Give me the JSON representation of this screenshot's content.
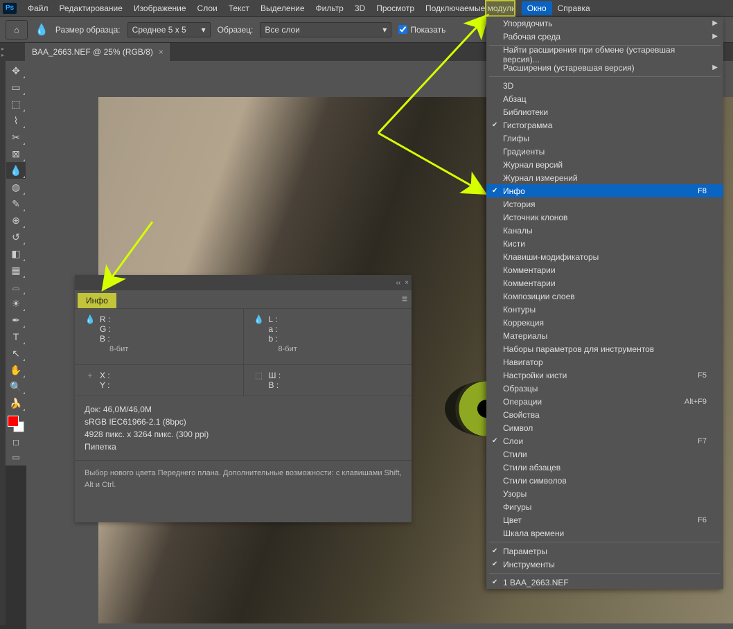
{
  "app": {
    "icon_label": "Ps"
  },
  "menubar": [
    "Файл",
    "Редактирование",
    "Изображение",
    "Слои",
    "Текст",
    "Выделение",
    "Фильтр",
    "3D",
    "Просмотр",
    "Подключаемые модули",
    "Окно",
    "Справка"
  ],
  "menubar_highlight_index": 10,
  "options": {
    "sample_label": "Размер образца:",
    "sample_value": "Среднее 5 x 5",
    "layers_label": "Образец:",
    "layers_value": "Все слои",
    "show_label": "Показать"
  },
  "doc_tab": "BAA_2663.NEF @ 25% (RGB/8)",
  "window_menu": {
    "groups": [
      [
        {
          "label": "Упорядочить",
          "sub": true
        },
        {
          "label": "Рабочая среда",
          "sub": true
        }
      ],
      [
        {
          "label": "Найти расширения при обмене (устаревшая версия)..."
        },
        {
          "label": "Расширения (устаревшая версия)",
          "sub": true
        }
      ],
      [
        {
          "label": "3D"
        },
        {
          "label": "Абзац"
        },
        {
          "label": "Библиотеки"
        },
        {
          "label": "Гистограмма",
          "chk": true
        },
        {
          "label": "Глифы"
        },
        {
          "label": "Градиенты"
        },
        {
          "label": "Журнал версий"
        },
        {
          "label": "Журнал измерений"
        },
        {
          "label": "Инфо",
          "chk": true,
          "sel": true,
          "short": "F8"
        },
        {
          "label": "История"
        },
        {
          "label": "Источник клонов"
        },
        {
          "label": "Каналы"
        },
        {
          "label": "Кисти"
        },
        {
          "label": "Клавиши-модификаторы"
        },
        {
          "label": "Комментарии"
        },
        {
          "label": "Комментарии"
        },
        {
          "label": "Композиции слоев"
        },
        {
          "label": "Контуры"
        },
        {
          "label": "Коррекция"
        },
        {
          "label": "Материалы"
        },
        {
          "label": "Наборы параметров для инструментов"
        },
        {
          "label": "Навигатор"
        },
        {
          "label": "Настройки кисти",
          "short": "F5"
        },
        {
          "label": "Образцы"
        },
        {
          "label": "Операции",
          "short": "Alt+F9"
        },
        {
          "label": "Свойства"
        },
        {
          "label": "Символ"
        },
        {
          "label": "Слои",
          "chk": true,
          "short": "F7"
        },
        {
          "label": "Стили"
        },
        {
          "label": "Стили абзацев"
        },
        {
          "label": "Стили символов"
        },
        {
          "label": "Узоры"
        },
        {
          "label": "Фигуры"
        },
        {
          "label": "Цвет",
          "short": "F6"
        },
        {
          "label": "Шкала времени"
        }
      ],
      [
        {
          "label": "Параметры",
          "chk": true
        },
        {
          "label": "Инструменты",
          "chk": true
        }
      ],
      [
        {
          "label": "1 BAA_2663.NEF",
          "chk": true
        }
      ]
    ]
  },
  "info_panel": {
    "tab": "Инфо",
    "rgb": {
      "r": "R  :",
      "g": "G  :",
      "b": "B  :",
      "bit": "8-бит"
    },
    "lab": {
      "l": "L  :",
      "a": "a  :",
      "b": "b  :",
      "bit": "8-бит"
    },
    "xy": {
      "x": "X  :",
      "y": "Y  :"
    },
    "wh": {
      "w": "Ш  :",
      "h": "В  :"
    },
    "doc1": "Док: 46,0M/46,0M",
    "doc2": "sRGB IEC61966-2.1 (8bpc)",
    "doc3": "4928 пикс. x 3264 пикс. (300 ppi)",
    "doc4": "Пипетка",
    "hint": "Выбор нового цвета Переднего плана. Дополнительные возможности: с клавишами Shift, Alt и Ctrl."
  },
  "tools": [
    {
      "name": "move-tool",
      "g": "✥"
    },
    {
      "name": "artboard-tool",
      "g": "▭"
    },
    {
      "name": "marquee-tool",
      "g": "⬚"
    },
    {
      "name": "lasso-tool",
      "g": "⌇"
    },
    {
      "name": "crop-tool",
      "g": "✂"
    },
    {
      "name": "frame-tool",
      "g": "⊠"
    },
    {
      "name": "eyedropper-tool",
      "g": "💧",
      "active": true
    },
    {
      "name": "heal-tool",
      "g": "◍"
    },
    {
      "name": "brush-tool",
      "g": "✎"
    },
    {
      "name": "stamp-tool",
      "g": "⊕"
    },
    {
      "name": "history-brush-tool",
      "g": "↺"
    },
    {
      "name": "eraser-tool",
      "g": "◧"
    },
    {
      "name": "gradient-tool",
      "g": "▦"
    },
    {
      "name": "blur-tool",
      "g": "⌓"
    },
    {
      "name": "dodge-tool",
      "g": "☀"
    },
    {
      "name": "pen-tool",
      "g": "✒"
    },
    {
      "name": "type-tool",
      "g": "T"
    },
    {
      "name": "path-tool",
      "g": "↖"
    },
    {
      "name": "hand-tool",
      "g": "✋"
    },
    {
      "name": "zoom-tool",
      "g": "🔍"
    },
    {
      "name": "banana-tool",
      "g": "🍌"
    }
  ]
}
